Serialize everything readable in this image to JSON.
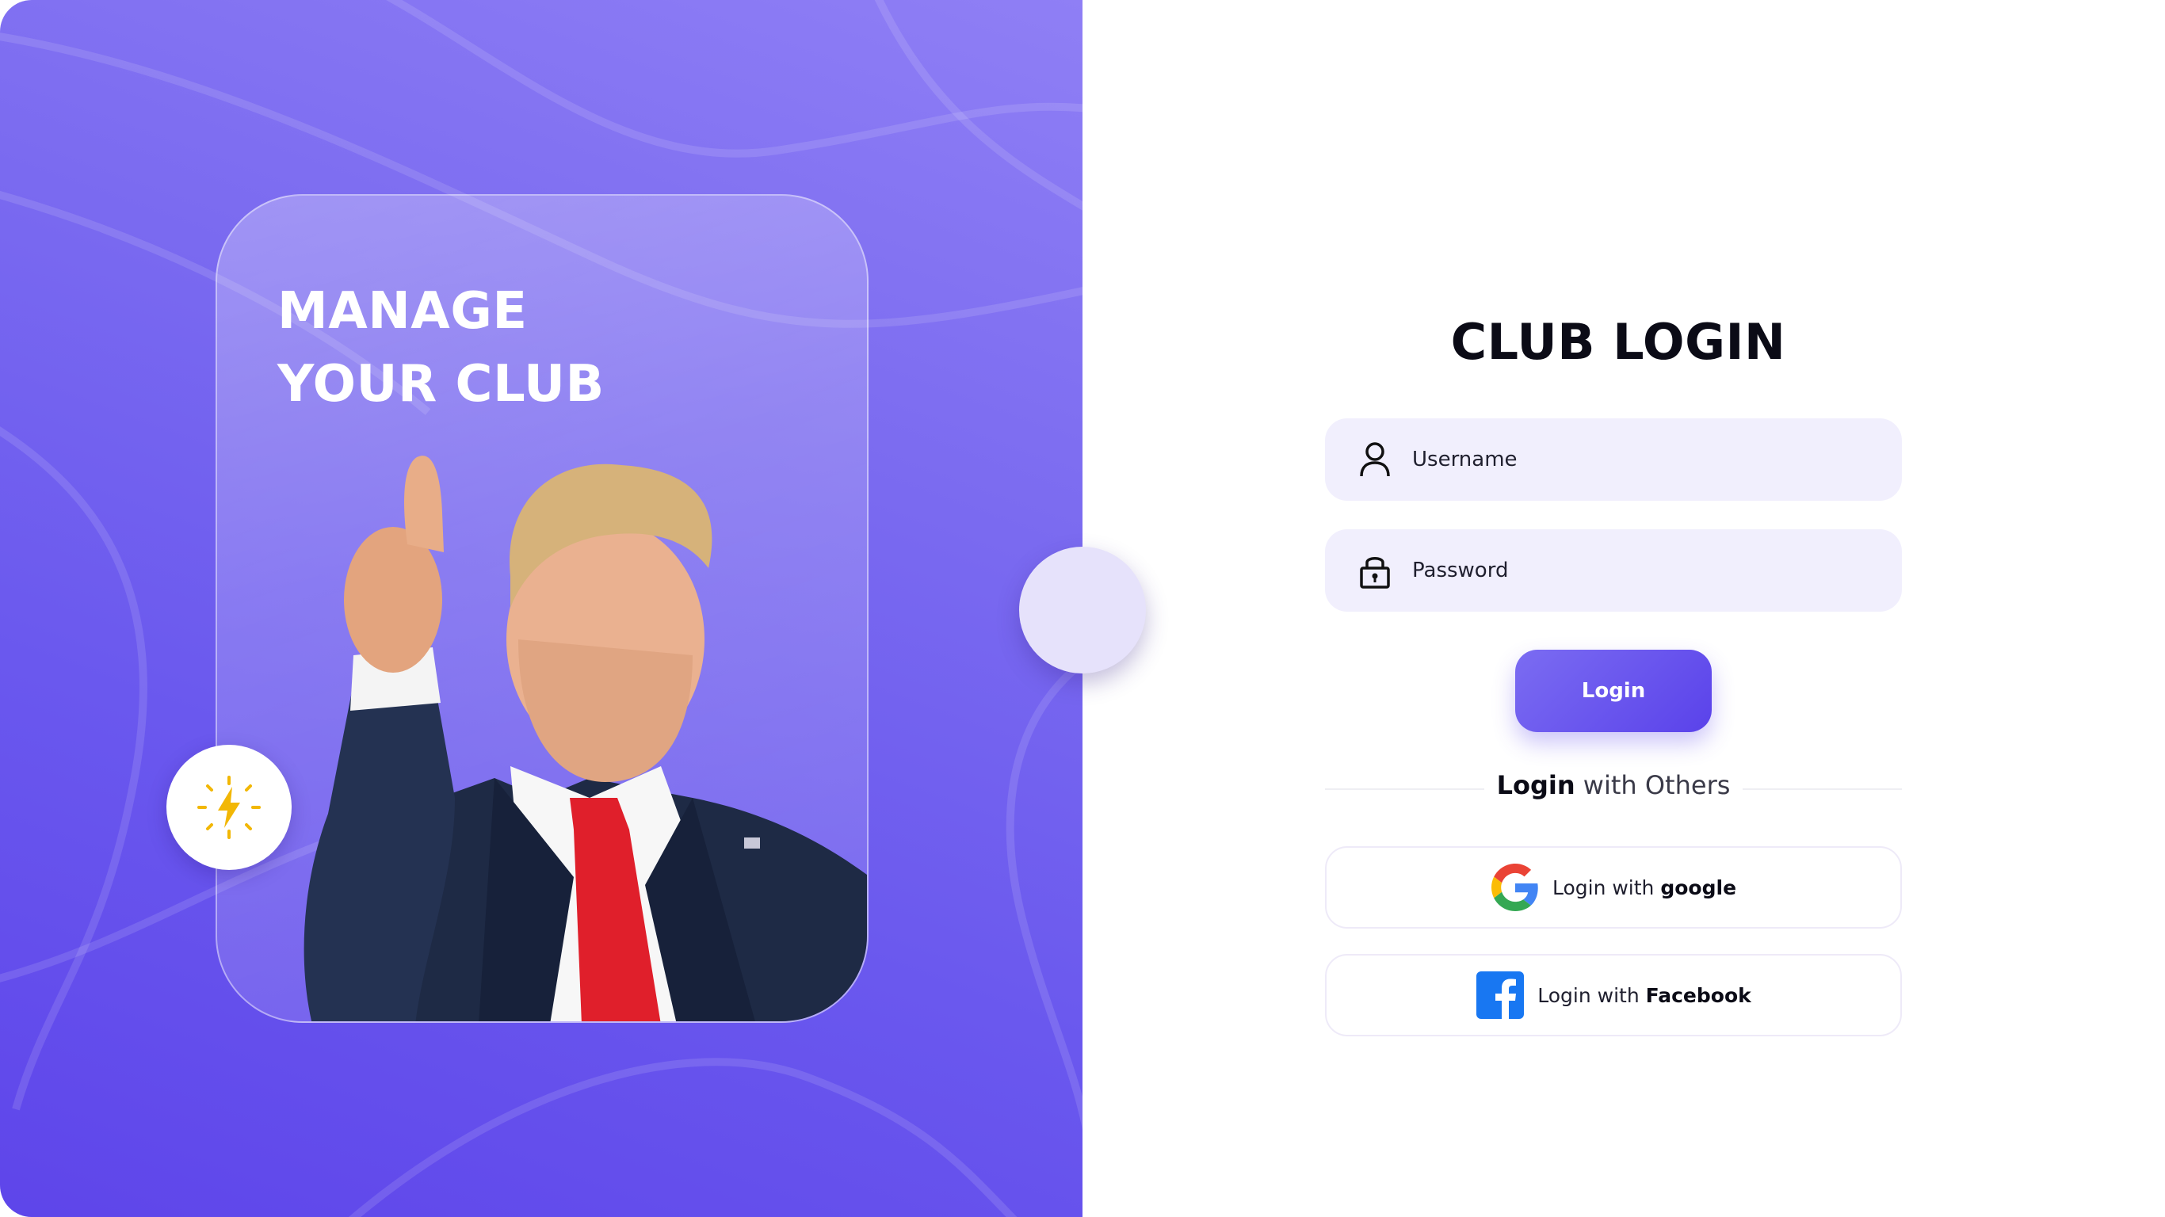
{
  "hero": {
    "title_line1": "MANAGE",
    "title_line2": "YOUR CLUB",
    "badge_icon": "lightning-icon",
    "accent_color": "#6b59ee",
    "badge_color": "#f2b705"
  },
  "form": {
    "title": "CLUB LOGIN",
    "username_placeholder": "Username",
    "username_icon": "user-icon",
    "password_placeholder": "Password",
    "password_icon": "lock-icon",
    "login_label": "Login",
    "field_bg": "#f1effd"
  },
  "divider": {
    "bold": "Login",
    "rest": " with Others"
  },
  "social": {
    "google_prefix": "Login with ",
    "google_name": "google",
    "google_icon": "google-logo-icon",
    "facebook_prefix": "Login with ",
    "facebook_name": "Facebook",
    "facebook_icon": "facebook-logo-icon",
    "facebook_color": "#1877f2"
  }
}
